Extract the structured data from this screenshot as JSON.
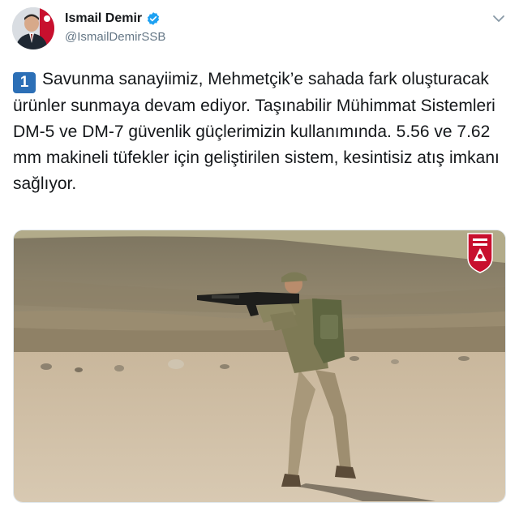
{
  "author": {
    "display_name": "Ismail Demir",
    "handle": "@IsmailDemirSSB",
    "verified": true,
    "avatar_icon": "profile-photo"
  },
  "tweet": {
    "thread_index": "1",
    "text": "Savunma sanayiimiz, Mehmetçik’e sahada fark oluşturacak ürünler sunmaya devam ediyor. Taşınabilir Mühimmat Sistemleri DM-5 ve DM-7 güvenlik güçlerimizin kullanımında. 5.56 ve 7.62 mm makineli tüfekler için geliştirilen sistem, kesintisiz atış imkanı sağlıyor."
  },
  "media": {
    "image_icon": "soldier-firing-rifle-photo",
    "emblem_icon": "ssb-emblem"
  },
  "colors": {
    "verified_blue": "#1da1f2",
    "keycap_blue": "#2c6fb6",
    "text": "#14171a",
    "muted": "#657786"
  }
}
